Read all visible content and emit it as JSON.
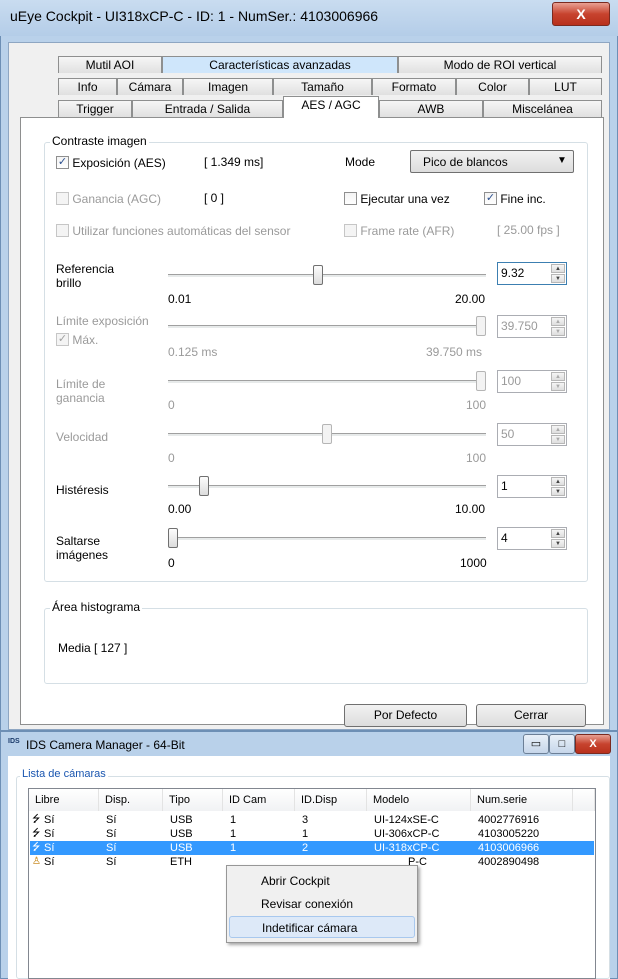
{
  "cockpit": {
    "title": "uEye Cockpit - UI318xCP-C - ID: 1 - NumSer.: 4103006966",
    "close_glyph": "X",
    "tabs_row1": [
      "Mutil AOI",
      "Características avanzadas",
      "Modo de ROI vertical"
    ],
    "tabs_row2": [
      "Info",
      "Cámara",
      "Imagen",
      "Tamaño",
      "Formato",
      "Color",
      "LUT"
    ],
    "tabs_row3": [
      "Trigger",
      "Entrada / Salida",
      "AES / AGC",
      "AWB",
      "Miscelánea"
    ],
    "contrast_group": {
      "title": "Contraste imagen",
      "exposure": {
        "label": "Exposición (AES)",
        "checked": true,
        "value": "[ 1.349 ms]"
      },
      "gain": {
        "label": "Ganancia (AGC)",
        "checked": false,
        "value": "[ 0 ]"
      },
      "sensor_auto": {
        "label": "Utilizar funciones automáticas del sensor",
        "checked": false
      },
      "mode_label": "Mode",
      "mode_value": "Pico de blancos",
      "run_once": {
        "label": "Ejecutar una vez",
        "checked": false
      },
      "fine_inc": {
        "label": "Fine inc.",
        "checked": true
      },
      "frame_rate": {
        "label": "Frame rate (AFR)",
        "checked": false,
        "value": "[ 25.00 fps ]"
      },
      "sliders": [
        {
          "label": "Referencia brillo",
          "min": "0.01",
          "max": "20.00",
          "value": "9.32",
          "enabled": true,
          "position": 0.47
        },
        {
          "label": "Límite exposición",
          "min": "0.125 ms",
          "max": "39.750 ms",
          "value": "39.750",
          "enabled": false,
          "position": 1.0,
          "check_label": "Máx.",
          "check_checked": true
        },
        {
          "label": "Límite de ganancia",
          "min": "0",
          "max": "100",
          "value": "100",
          "enabled": false,
          "position": 1.0
        },
        {
          "label": "Velocidad",
          "min": "0",
          "max": "100",
          "value": "50",
          "enabled": false,
          "position": 0.5
        },
        {
          "label": "Histéresis",
          "min": "0.00",
          "max": "10.00",
          "value": "1",
          "enabled": true,
          "position": 0.1
        },
        {
          "label": "Saltarse imágenes",
          "min": "0",
          "max": "1000",
          "value": "4",
          "enabled": true,
          "position": 0.0
        }
      ]
    },
    "histogram_group": {
      "title": "Área histograma",
      "media": "Media [ 127 ]"
    },
    "buttons": {
      "default": "Por Defecto",
      "close": "Cerrar"
    }
  },
  "manager": {
    "icon_text": "IDS",
    "title": "IDS Camera Manager - 64-Bit",
    "group_title": "Lista de cámaras",
    "columns": [
      "Libre",
      "Disp.",
      "Tipo",
      "ID Cam",
      "ID.Disp",
      "Modelo",
      "Num.serie"
    ],
    "rows": [
      {
        "libre": "Sí",
        "disp": "Sí",
        "tipo": "USB",
        "idcam": "1",
        "iddisp": "3",
        "modelo": "UI-124xSE-C",
        "serie": "4002776916",
        "icon": "usb-icon",
        "selected": false
      },
      {
        "libre": "Sí",
        "disp": "Sí",
        "tipo": "USB",
        "idcam": "1",
        "iddisp": "1",
        "modelo": "UI-306xCP-C",
        "serie": "4103005220",
        "icon": "usb-icon",
        "selected": false
      },
      {
        "libre": "Sí",
        "disp": "Sí",
        "tipo": "USB",
        "idcam": "1",
        "iddisp": "2",
        "modelo": "UI-318xCP-C",
        "serie": "4103006966",
        "icon": "usb-icon",
        "selected": true
      },
      {
        "libre": "Sí",
        "disp": "Sí",
        "tipo": "ETH",
        "idcam": "",
        "iddisp": "",
        "modelo": "P-C",
        "serie": "4002890498",
        "icon": "ethernet-icon",
        "selected": false
      }
    ],
    "context_menu": [
      "Abrir Cockpit",
      "Revisar conexión",
      "Indetificar cámara"
    ]
  },
  "colors": {
    "selection": "#3399ff",
    "window_frame": "#b9d1ea",
    "close_red": "#c7432e"
  }
}
